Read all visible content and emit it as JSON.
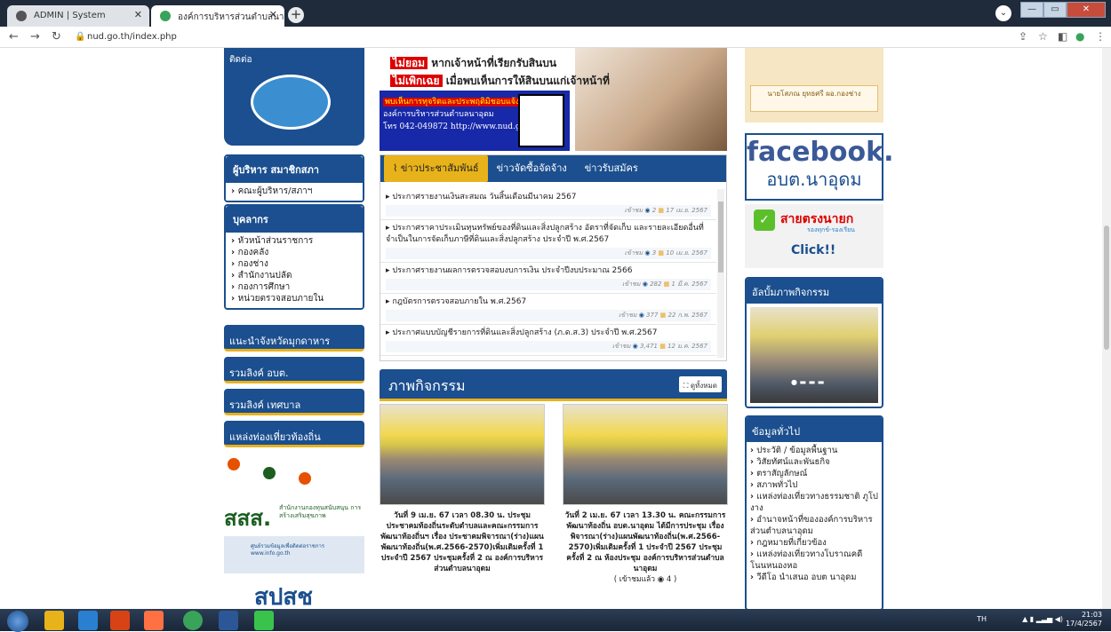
{
  "browser": {
    "tabs": [
      {
        "title": "ADMIN | System",
        "favicon_color": "#555555"
      },
      {
        "title": "องค์การบริหารส่วนตำบลนาอุดม อำ...",
        "favicon_color": "#3aa35a"
      }
    ],
    "url": "nud.go.th/index.php"
  },
  "left": {
    "logo_label": "ติดต่อ",
    "admin_box": {
      "title": "ผู้บริหาร สมาชิกสภา",
      "items": [
        "คณะผู้บริหาร/สภาฯ"
      ]
    },
    "staff_box": {
      "title": "บุคลากร",
      "items": [
        "หัวหน้าส่วนราชการ",
        "กองคลัง",
        "กองช่าง",
        "สำนักงานปลัด",
        "กองการศึกษา",
        "หน่วยตรวจสอบภายใน"
      ]
    },
    "buttons": [
      "แนะนำจังหวัดมุกดาหาร",
      "รวมลิงค์ อบต.",
      "รวมลิงค์ เทศบาล",
      "แหล่งท่องเที่ยวท้องถิ่น"
    ],
    "sss_title": "สสส.",
    "sss_sub": "สำนักงานกองทุนสนับสนุน การสร้างเสริมสุขภาพ",
    "info_banner": "ศูนย์รวมข้อมูลเพื่อติดต่อราชการ www.info.go.th",
    "sps_label": "สปสช"
  },
  "ad": {
    "line1_tag": "ไม่ยอม",
    "line1": "หากเจ้าหน้าที่เรียกรับสินบน",
    "line2_tag": "ไม่เพิกเฉย",
    "line2": "เมื่อพบเห็นการให้สินบนแก่เจ้าหน้าที่",
    "report_tag": "พบเห็นการทุจริตและประพฤติมิชอบแจ้ง",
    "org": "องค์การบริหารส่วนตำบลนาอุดม",
    "contact": "โทร 042-049872 http://www.nud.go.th"
  },
  "news": {
    "tabs": [
      "ข่าวประชาสัมพันธ์",
      "ข่าวจัดซื้อจัดจ้าง",
      "ข่าวรับสมัคร"
    ],
    "items": [
      {
        "title": "ประกาศรายงานเงินสะสมณ วันสิ้นเดือนมีนาคม 2567",
        "views": "2",
        "date": "17 เม.ย. 2567"
      },
      {
        "title": "ประกาศราคาประเมินทุนทรัพย์ของที่ดินและสิ่งปลูกสร้าง อัตราที่จัดเก็บ และรายละเอียดอื่นที่จำเป็นในการจัดเก็บภาษีที่ดินและสิ่งปลูกสร้าง ประจำปี พ.ศ.2567",
        "views": "3",
        "date": "10 เม.ย. 2567"
      },
      {
        "title": "ประกาศรายงานผลการตรวจสอบงบการเงิน ประจำปีงบประมาณ 2566",
        "views": "282",
        "date": "1 มี.ค. 2567"
      },
      {
        "title": "กฎบัตรการตรวจสอบภายใน พ.ศ.2567",
        "views": "377",
        "date": "22 ก.พ. 2567"
      },
      {
        "title": "ประกาศแบบบัญชีรายการที่ดินและสิ่งปลูกสร้าง (ภ.ด.ส.3) ประจำปี พ.ศ.2567",
        "views": "3,471",
        "date": "12 ม.ค. 2567"
      }
    ],
    "read_label": "เข้าชม"
  },
  "activity": {
    "title": "ภาพกิจกรรม",
    "all_label": "ดูทั้งหมด",
    "cards": [
      {
        "caption": "วันที่ 9 เม.ย. 67 เวลา 08.30 น. ประชุมประชาคมท้องถิ่นระดับตำบลและคณะกรรมการพัฒนาท้องถิ่นฯ เรื่อง ประชาคมพิจารณา(ร่าง)แผนพัฒนาท้องถิ่น(พ.ศ.2566-2570)เพิ่มเติมครั้งที่ 1 ประจำปี 2567 ประชุมครั้งที่ 2 ณ องค์การบริหารส่วนตำบลนาอุดม",
        "views": ""
      },
      {
        "caption": "วันที่ 2 เม.ย. 67 เวลา 13.30 น. คณะกรรมการพัฒนาท้องถิ่น อบต.นาอุดม ได้มีการประชุม เรื่อง พิจารณา(ร่าง)แผนพัฒนาท้องถิ่น(พ.ศ.2566-2570)เพิ่มเติมครั้งที่ 1 ประจำปี 2567 ประชุมครั้งที่ 2 ณ ห้องประชุม องค์การบริหารส่วนตำบลนาอุดม",
        "views": "( เข้าชมแล้ว ◉ 4 )"
      }
    ]
  },
  "right": {
    "person_caption": "นายโสภณ ยุทธศรี ผอ.กองช่าง",
    "facebook": "facebook.",
    "facebook_sub": "อบต.นาอุดม",
    "hotline": "สายตรงนายก",
    "hotline_sub": "รองทุกข์-รองเรียน",
    "click": "Click!!",
    "album_title": "อัลบั้มภาพกิจกรรม",
    "general_title": "ข้อมูลทั่วไป",
    "general_items": [
      "ประวัติ / ข้อมูลพื้นฐาน",
      "วิสัยทัศน์และพันธกิจ",
      "ตราสัญลักษณ์",
      "สภาพทั่วไป",
      "แหล่งท่องเที่ยวทางธรรมชาติ ภูโปงาง",
      "อำนาจหน้าที่ขององค์การบริหารส่วนตำบลนาอุดม",
      "กฎหมายที่เกี่ยวข้อง",
      "แหล่งท่องเที่ยวทางโบราณคดี โนนหนองหอ",
      "วีดีโอ นำเสนอ อบต นาอุดม"
    ]
  },
  "taskbar": {
    "lang": "TH",
    "time": "21:03",
    "date": "17/4/2567"
  }
}
